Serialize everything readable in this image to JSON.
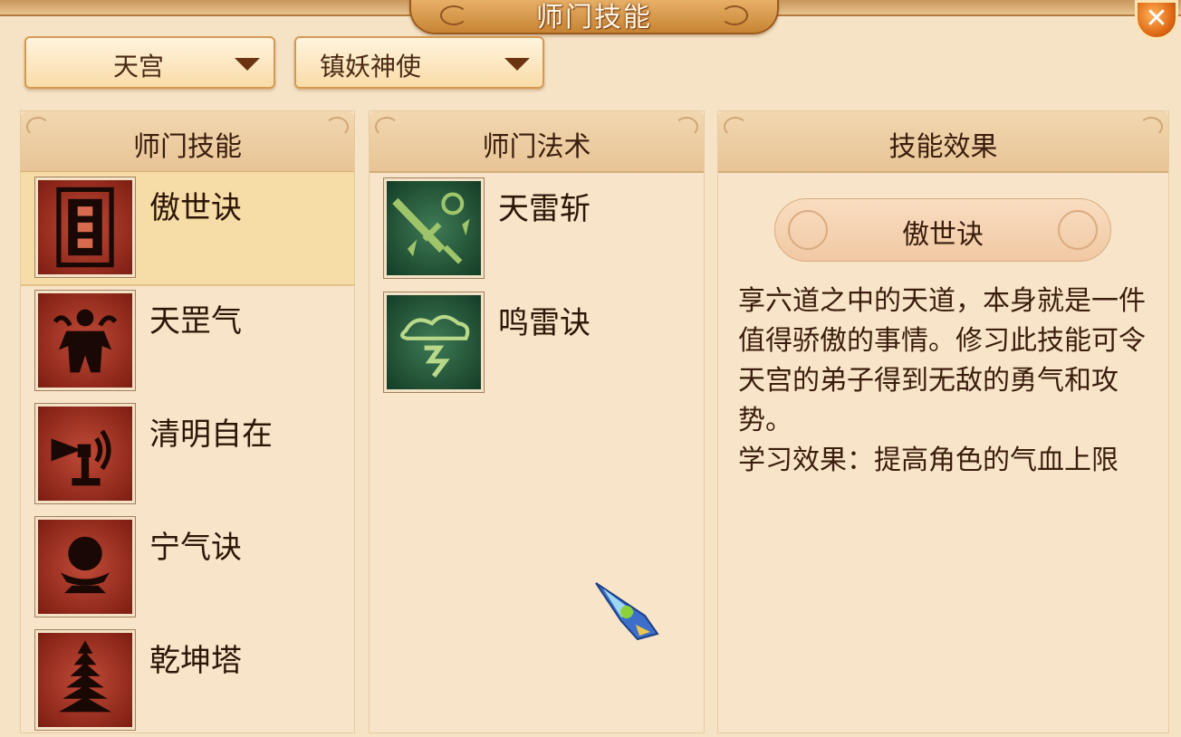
{
  "window": {
    "title": "师门技能",
    "close_label": "✕"
  },
  "filters": {
    "school": {
      "value": "天宫"
    },
    "rank": {
      "value": "镇妖神使"
    }
  },
  "skills_panel": {
    "header": "师门技能",
    "items": [
      {
        "name": "傲世诀",
        "icon": "scroll-icon",
        "selected": true
      },
      {
        "name": "天罡气",
        "icon": "warrior-icon"
      },
      {
        "name": "清明自在",
        "icon": "horn-icon"
      },
      {
        "name": "宁气诀",
        "icon": "orb-icon"
      },
      {
        "name": "乾坤塔",
        "icon": "pagoda-icon"
      }
    ]
  },
  "spells_panel": {
    "header": "师门法术",
    "items": [
      {
        "name": "天雷斩",
        "icon": "thunder-sword-icon"
      },
      {
        "name": "鸣雷诀",
        "icon": "thunder-cloud-icon"
      }
    ]
  },
  "effect_panel": {
    "header": "技能效果",
    "skill_name": "傲世诀",
    "description": "享六道之中的天道，本身就是一件值得骄傲的事情。修习此技能可令天宫的弟子得到无敌的勇气和攻势。",
    "learn_effect": "学习效果：提高角色的气血上限"
  },
  "colors": {
    "accent": "#c88434",
    "selected_row": "#f6dca6",
    "panel_bg": "#f8e5c9"
  }
}
